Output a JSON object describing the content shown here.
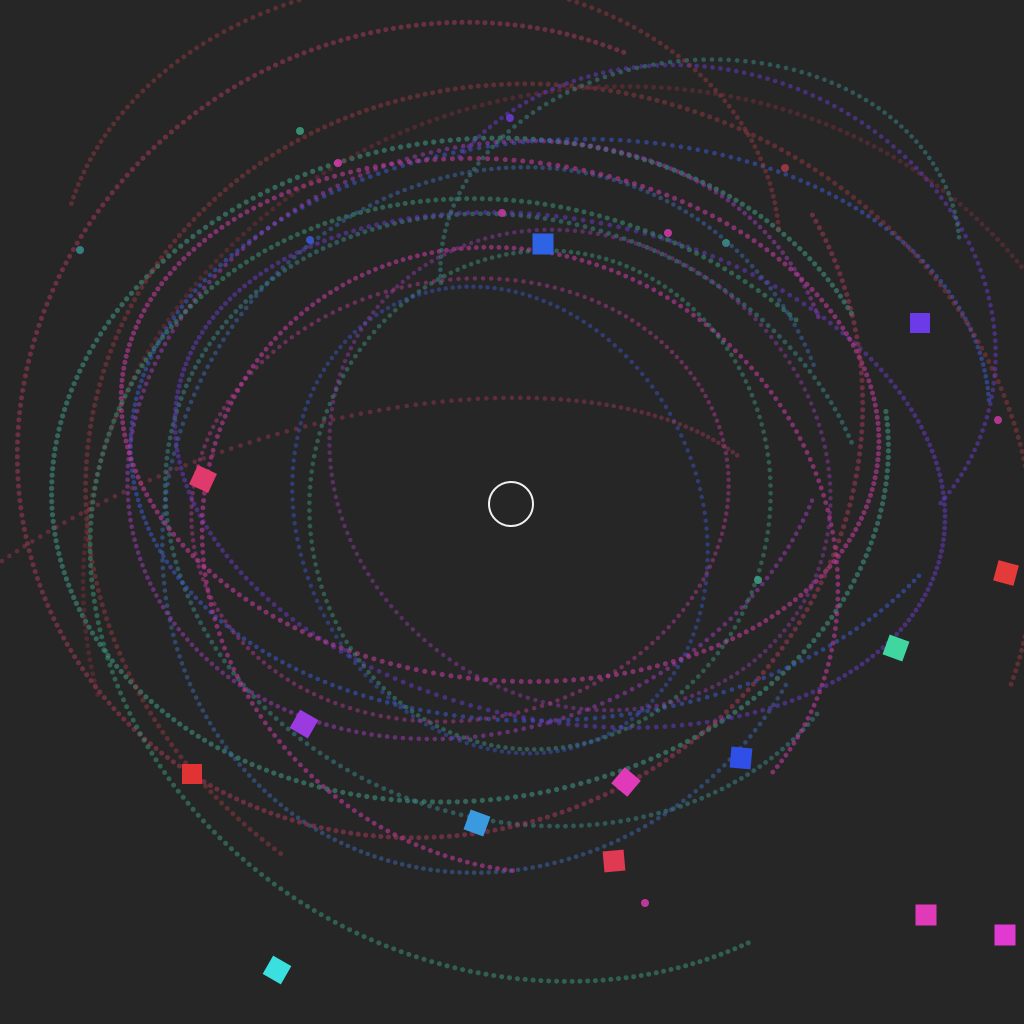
{
  "scene": {
    "background": "#262626",
    "center_marker": {
      "shape": "ring",
      "color": "#ffffff"
    },
    "trail_style": "dotted",
    "particles": [
      {
        "name": "square-blue-top",
        "color": "#2f63e6"
      },
      {
        "name": "square-violet-right",
        "color": "#6a3be6"
      },
      {
        "name": "square-crimson-left",
        "color": "#e03a6c"
      },
      {
        "name": "square-red-right",
        "color": "#e43a3a"
      },
      {
        "name": "square-green-right",
        "color": "#3fd6a0"
      },
      {
        "name": "square-blue-lower",
        "color": "#2f4fe6"
      },
      {
        "name": "square-magenta-lower",
        "color": "#e03ab8"
      },
      {
        "name": "square-purple-left",
        "color": "#9a3ae0"
      },
      {
        "name": "square-red-left",
        "color": "#e03434"
      },
      {
        "name": "square-skyblue-lower",
        "color": "#3a9ae0"
      },
      {
        "name": "square-red-bottom",
        "color": "#e03a52"
      },
      {
        "name": "square-cyan-bottom",
        "color": "#3ae0e0"
      },
      {
        "name": "square-magenta-bottom",
        "color": "#e03ab8"
      },
      {
        "name": "square-magenta-corner",
        "color": "#e03ad0"
      }
    ],
    "trails": [
      {
        "name": "trail-teal-a",
        "color": "#3f9a86"
      },
      {
        "name": "trail-teal-b",
        "color": "#3a8a8a"
      },
      {
        "name": "trail-blue-a",
        "color": "#3a5ad0"
      },
      {
        "name": "trail-blue-b",
        "color": "#3a6ab0"
      },
      {
        "name": "trail-violet-a",
        "color": "#6a3ad0"
      },
      {
        "name": "trail-purple-a",
        "color": "#9a3ab0"
      },
      {
        "name": "trail-magenta-a",
        "color": "#c03a9a"
      },
      {
        "name": "trail-magenta-b",
        "color": "#d03aa8"
      },
      {
        "name": "trail-crimson-a",
        "color": "#b03a5a"
      },
      {
        "name": "trail-red-a",
        "color": "#a03a44"
      },
      {
        "name": "trail-red-b",
        "color": "#8a3040"
      },
      {
        "name": "trail-green-a",
        "color": "#3a9a7a"
      }
    ]
  }
}
